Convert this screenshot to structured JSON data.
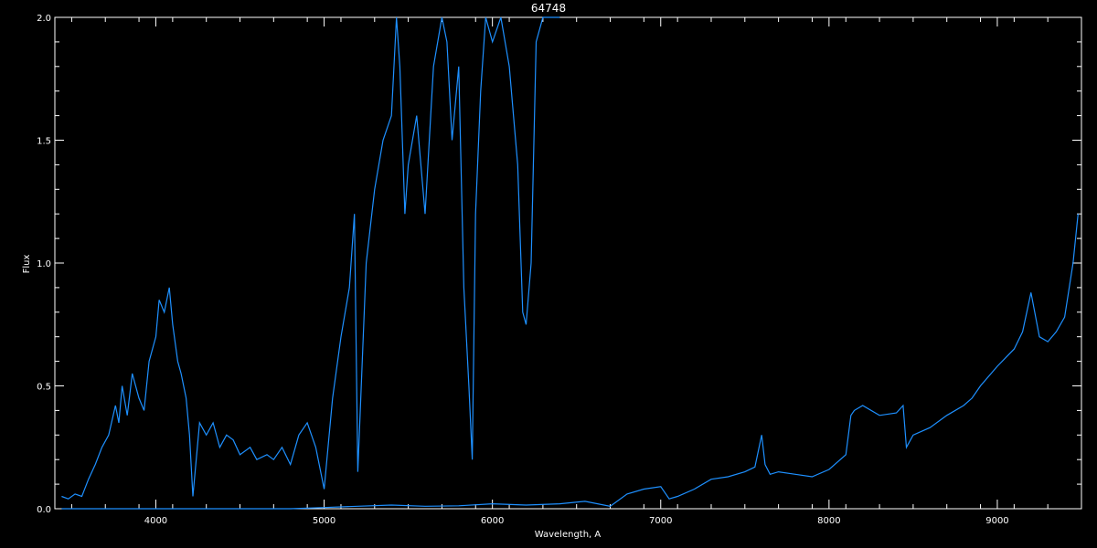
{
  "chart_data": {
    "type": "line",
    "title": "64748",
    "xlabel": "Wavelength, A",
    "ylabel": "Flux",
    "xlim": [
      3400,
      9500
    ],
    "ylim": [
      0,
      2.0
    ],
    "xticks": [
      4000,
      5000,
      6000,
      7000,
      8000,
      9000
    ],
    "yticks": [
      0.0,
      0.5,
      1.0,
      1.5,
      2.0
    ],
    "ytick_labels": [
      "0.0",
      "0.5",
      "1.0",
      "1.5",
      "2.0"
    ],
    "grid": false,
    "colors": {
      "background": "#000000",
      "axes": "#ffffff",
      "series": "#1e90ff"
    },
    "series": [
      {
        "values_x": [
          3440,
          3480,
          3520,
          3560,
          3600,
          3640,
          3680,
          3720,
          3760,
          3780,
          3800,
          3830,
          3860,
          3900,
          3930,
          3960,
          4000,
          4020,
          4050,
          4080,
          4100,
          4130,
          4150,
          4180,
          4200,
          4220,
          4260,
          4300,
          4340,
          4380,
          4420,
          4460,
          4500,
          4560,
          4600,
          4660,
          4700,
          4750,
          4800,
          4850,
          4900,
          4950,
          5000,
          5050,
          5100,
          5150,
          5180,
          5200,
          5250,
          5300,
          5350,
          5400,
          5430,
          5450,
          5480,
          5500,
          5550,
          5600,
          5650,
          5700,
          5730,
          5760,
          5800,
          5830,
          5860,
          5880,
          5900,
          5930,
          5960,
          6000,
          6050,
          6100,
          6150,
          6180,
          6200,
          6230,
          6260,
          6300,
          6350,
          6400
        ],
        "values_y": [
          0.05,
          0.04,
          0.06,
          0.05,
          0.12,
          0.18,
          0.25,
          0.3,
          0.42,
          0.35,
          0.5,
          0.38,
          0.55,
          0.45,
          0.4,
          0.6,
          0.7,
          0.85,
          0.8,
          0.9,
          0.75,
          0.6,
          0.55,
          0.45,
          0.3,
          0.05,
          0.35,
          0.3,
          0.35,
          0.25,
          0.3,
          0.28,
          0.22,
          0.25,
          0.2,
          0.22,
          0.2,
          0.25,
          0.18,
          0.3,
          0.35,
          0.25,
          0.08,
          0.45,
          0.7,
          0.9,
          1.2,
          0.15,
          1.0,
          1.3,
          1.5,
          1.6,
          2.0,
          1.8,
          1.2,
          1.4,
          1.6,
          1.2,
          1.8,
          2.0,
          1.9,
          1.5,
          1.8,
          0.9,
          0.5,
          0.2,
          1.2,
          1.7,
          2.0,
          1.9,
          2.0,
          1.8,
          1.4,
          0.8,
          0.75,
          1.0,
          1.9,
          2.0,
          2.0,
          2.0
        ]
      },
      {
        "values_x": [
          3440,
          3600,
          3800,
          4000,
          4200,
          4400,
          4600,
          4800,
          5000,
          5200,
          5400,
          5600,
          5800,
          6000,
          6200,
          6400,
          6550,
          6700,
          6800,
          6900,
          7000,
          7050,
          7100,
          7200,
          7300,
          7400,
          7500,
          7560,
          7600,
          7620,
          7650,
          7700,
          7800,
          7900,
          8000,
          8100,
          8130,
          8150,
          8200,
          8300,
          8400,
          8440,
          8460,
          8500,
          8600,
          8700,
          8800,
          8850,
          8900,
          9000,
          9100,
          9150,
          9200,
          9250,
          9300,
          9350,
          9400,
          9450,
          9480
        ],
        "values_y": [
          0.0,
          0.0,
          0.0,
          0.0,
          0.0,
          0.0,
          0.0,
          0.0,
          0.005,
          0.01,
          0.015,
          0.01,
          0.012,
          0.02,
          0.015,
          0.02,
          0.03,
          0.01,
          0.06,
          0.08,
          0.09,
          0.04,
          0.05,
          0.08,
          0.12,
          0.13,
          0.15,
          0.17,
          0.3,
          0.18,
          0.14,
          0.15,
          0.14,
          0.13,
          0.16,
          0.22,
          0.38,
          0.4,
          0.42,
          0.38,
          0.39,
          0.42,
          0.25,
          0.3,
          0.33,
          0.38,
          0.42,
          0.45,
          0.5,
          0.58,
          0.65,
          0.72,
          0.88,
          0.7,
          0.68,
          0.72,
          0.78,
          1.0,
          1.2
        ]
      }
    ]
  }
}
